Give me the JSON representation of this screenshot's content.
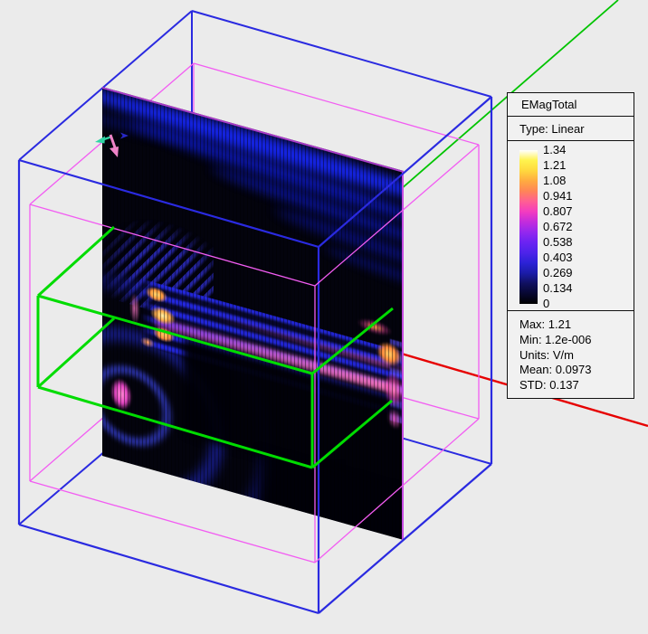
{
  "window": {
    "background_color": "#ebebeb"
  },
  "viewport": {
    "description": "3D field-plot view",
    "field_plane": {
      "quantity": "EMagTotal",
      "border_color": "#b840d8"
    },
    "objects": {
      "outer_box_color": "#2a2ae0",
      "inner_box_color": "#f25cf2",
      "waveguide_box_color": "#00dc00"
    },
    "axes": {
      "x_axis_color": "#e60000",
      "y_axis_color": "#00c400"
    },
    "plane_triad": {
      "u_color": "#2fd4a4",
      "v_color": "#ef83c8",
      "n_color": "#2828c8"
    }
  },
  "legend": {
    "title": "EMagTotal",
    "type_label": "Type: Linear",
    "scale_values": [
      "1.34",
      "1.21",
      "1.08",
      "0.941",
      "0.807",
      "0.672",
      "0.538",
      "0.403",
      "0.269",
      "0.134",
      "0"
    ],
    "stats": [
      "Max: 1.21",
      "Min: 1.2e-006",
      "Units: V/m",
      "Mean: 0.0973",
      "STD: 0.137"
    ],
    "colormap": [
      "#ffffff",
      "#fff34e",
      "#ffd83e",
      "#ffab40",
      "#ff8557",
      "#ff5f93",
      "#f33cc0",
      "#c32cdc",
      "#9428ee",
      "#6b23f2",
      "#4d23ea",
      "#2b22d6",
      "#1b1ca8",
      "#101060",
      "#070730",
      "#000000"
    ]
  }
}
